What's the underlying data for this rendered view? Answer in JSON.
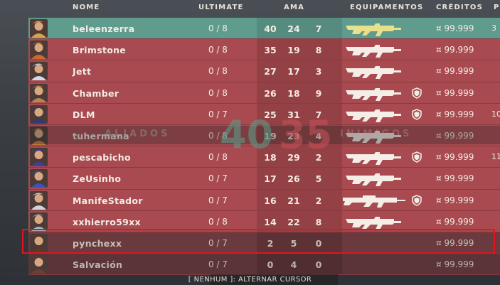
{
  "header": {
    "name": "NOME",
    "ultimate": "ULTIMATE",
    "kda": "AMA",
    "equip": "EQUIPAMENTOS",
    "credits": "CRÉDITOS",
    "extra": "PI"
  },
  "overlay": {
    "ally_label": "ALIADOS",
    "enemy_label": "INIMIGOS",
    "ally_score": "40",
    "enemy_score": "35"
  },
  "players": [
    {
      "name": "beleenzerra",
      "ult": "0 / 8",
      "k": "40",
      "d": "24",
      "a": "7",
      "credits": "¤ 99.999",
      "extra": "3",
      "weapon": "rifle",
      "shield": false,
      "style": "self",
      "avatar_color": "#d8a24a"
    },
    {
      "name": "Brimstone",
      "ult": "0 / 8",
      "k": "35",
      "d": "19",
      "a": "8",
      "credits": "¤ 99.999",
      "extra": "",
      "weapon": "rifle",
      "shield": false,
      "style": "",
      "avatar_color": "#c8692f"
    },
    {
      "name": "Jett",
      "ult": "0 / 8",
      "k": "27",
      "d": "17",
      "a": "3",
      "credits": "¤ 99.999",
      "extra": "",
      "weapon": "rifle",
      "shield": false,
      "style": "",
      "avatar_color": "#cfd9e8"
    },
    {
      "name": "Chamber",
      "ult": "0 / 8",
      "k": "26",
      "d": "18",
      "a": "9",
      "credits": "¤ 99.999",
      "extra": "",
      "weapon": "rifle",
      "shield": true,
      "style": "",
      "avatar_color": "#b88452"
    },
    {
      "name": "DLM",
      "ult": "0 / 7",
      "k": "25",
      "d": "31",
      "a": "7",
      "credits": "¤ 99.999",
      "extra": "10",
      "weapon": "rifle",
      "shield": true,
      "style": "",
      "avatar_color": "#2d3a7a"
    },
    {
      "name": "tuhermana",
      "ult": "0 / 8",
      "k": "19",
      "d": "23",
      "a": "4",
      "credits": "¤ 99.999",
      "extra": "",
      "weapon": "rifle",
      "shield": false,
      "style": "",
      "avatar_color": "#c27b3d"
    },
    {
      "name": "pescabicho",
      "ult": "0 / 8",
      "k": "18",
      "d": "29",
      "a": "2",
      "credits": "¤ 99.999",
      "extra": "11",
      "weapon": "rifle",
      "shield": true,
      "style": "",
      "avatar_color": "#3c3f9c"
    },
    {
      "name": "ZeUsinho",
      "ult": "0 / 7",
      "k": "17",
      "d": "26",
      "a": "5",
      "credits": "¤ 99.999",
      "extra": "",
      "weapon": "rifle",
      "shield": false,
      "style": "",
      "avatar_color": "#3555b8"
    },
    {
      "name": "ManifeStador",
      "ult": "0 / 7",
      "k": "16",
      "d": "21",
      "a": "2",
      "credits": "¤ 99.999",
      "extra": "",
      "weapon": "sniper",
      "shield": true,
      "style": "",
      "avatar_color": "#cfd4da"
    },
    {
      "name": "xxhierro59xx",
      "ult": "0 / 8",
      "k": "14",
      "d": "22",
      "a": "8",
      "credits": "¤ 99.999",
      "extra": "",
      "weapon": "rifle",
      "shield": false,
      "style": "",
      "avatar_color": "#a9b6c4"
    },
    {
      "name": "pynchexx",
      "ult": "0 / 7",
      "k": "2",
      "d": "5",
      "a": "0",
      "credits": "¤ 99.999",
      "extra": "",
      "weapon": "",
      "shield": false,
      "style": "dim",
      "avatar_color": "#5a3a2c"
    },
    {
      "name": "Salvación",
      "ult": "0 / 7",
      "k": "0",
      "d": "4",
      "a": "0",
      "credits": "¤ 99.999",
      "extra": "",
      "weapon": "",
      "shield": false,
      "style": "dim2",
      "avatar_color": "#6b4030"
    }
  ],
  "footer": "[ NENHUM ]: ALTERNAR CURSOR",
  "colors": {
    "ally_row": "#5f9c8e",
    "enemy_row": "#a94a50",
    "highlight": "#e2141e",
    "self_weapon": "#e8e08a"
  }
}
